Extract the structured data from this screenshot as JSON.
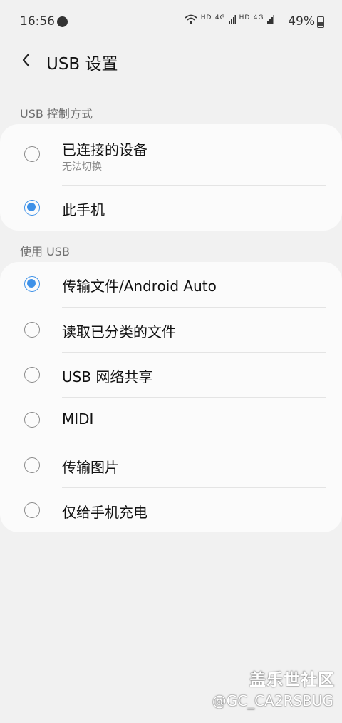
{
  "status": {
    "time": "16:56",
    "hd1": "HD",
    "net1": "4G",
    "hd2": "HD",
    "net2": "4G",
    "battery": "49%"
  },
  "header": {
    "title": "USB 设置"
  },
  "control": {
    "label": "USB 控制方式",
    "options": [
      {
        "label": "已连接的设备",
        "sublabel": "无法切换",
        "checked": false
      },
      {
        "label": "此手机",
        "checked": true
      }
    ]
  },
  "usage": {
    "label": "使用 USB",
    "options": [
      {
        "label": "传输文件/Android Auto",
        "checked": true
      },
      {
        "label": "读取已分类的文件",
        "checked": false
      },
      {
        "label": "USB 网络共享",
        "checked": false
      },
      {
        "label": "MIDI",
        "checked": false
      },
      {
        "label": "传输图片",
        "checked": false
      },
      {
        "label": "仅给手机充电",
        "checked": false
      }
    ]
  },
  "watermark": {
    "line1": "盖乐世社区",
    "line2": "@GC_CA2RSBUG"
  }
}
